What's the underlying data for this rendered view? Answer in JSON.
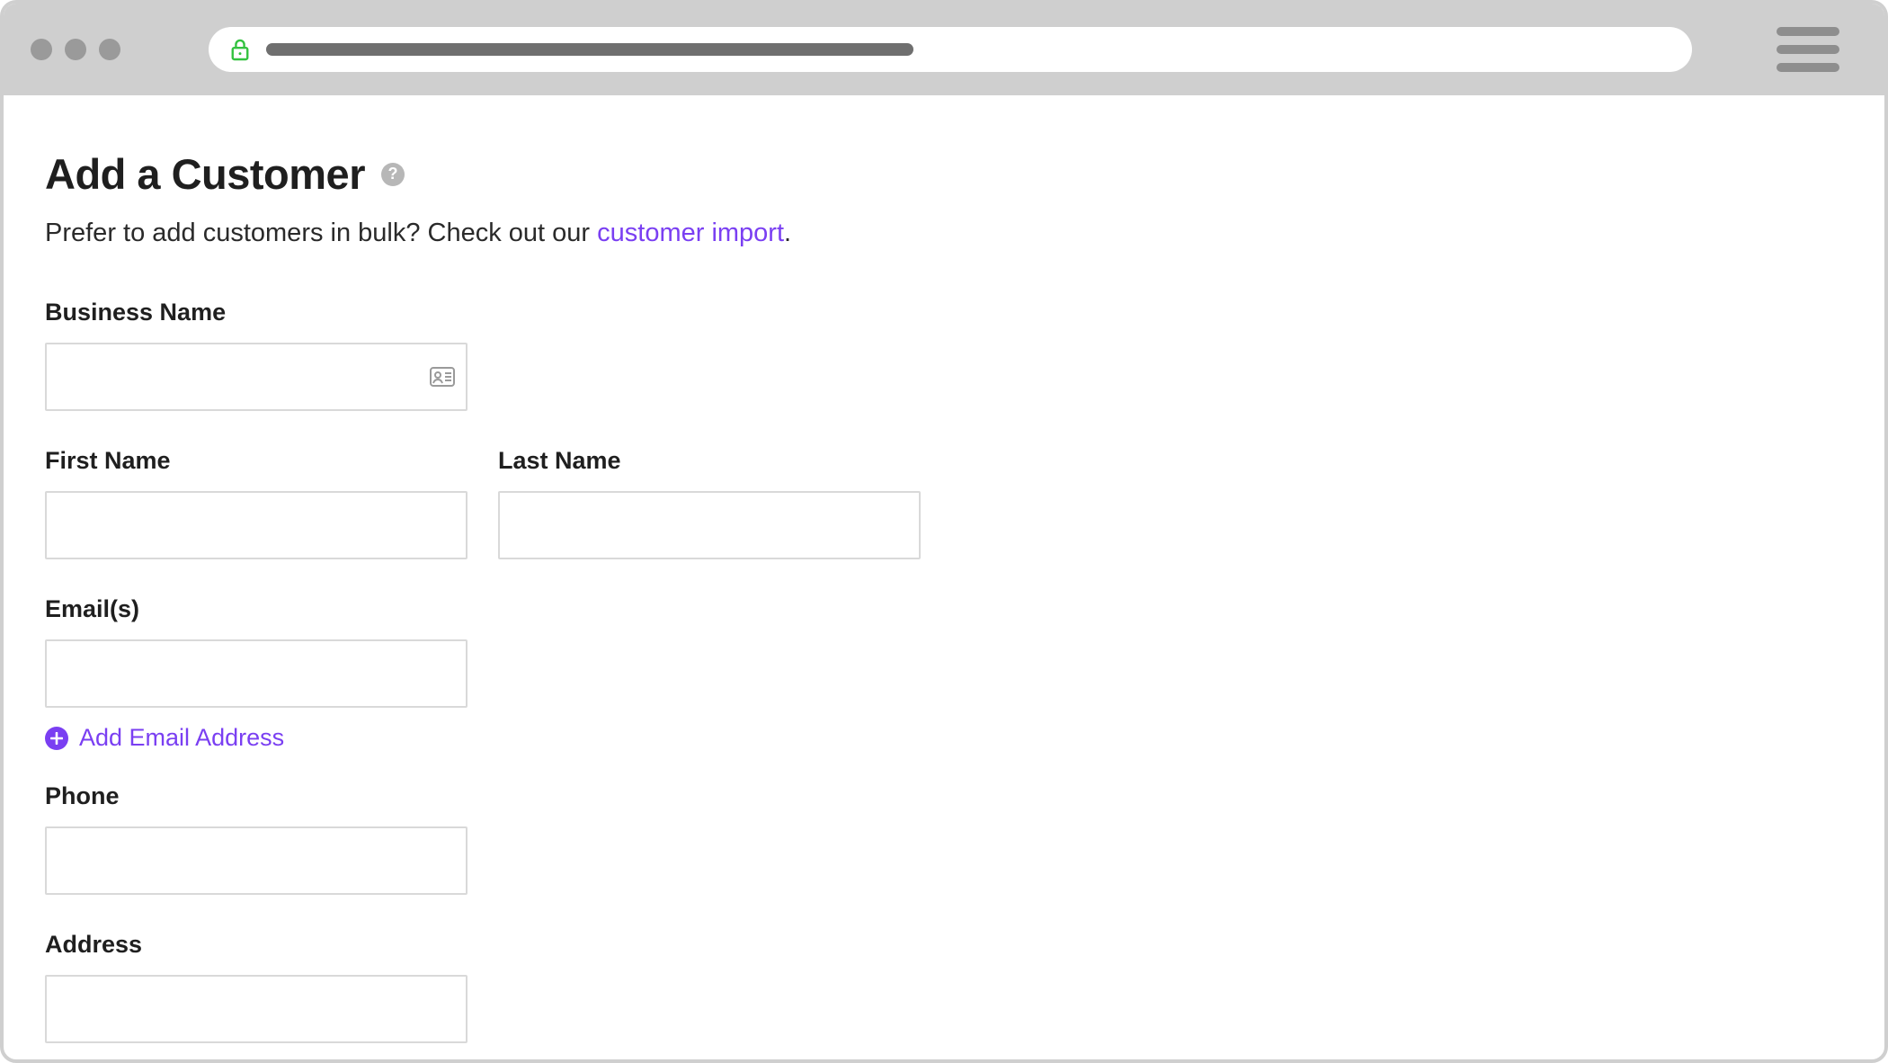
{
  "browser": {
    "menu_label": "Menu"
  },
  "page": {
    "title": "Add a Customer",
    "help_tooltip": "?",
    "subheader_prefix": "Prefer to add customers in bulk? Check out our ",
    "subheader_link": "customer import",
    "subheader_suffix": "."
  },
  "form": {
    "business_name": {
      "label": "Business Name",
      "value": ""
    },
    "first_name": {
      "label": "First Name",
      "value": ""
    },
    "last_name": {
      "label": "Last Name",
      "value": ""
    },
    "emails": {
      "label": "Email(s)",
      "value": "",
      "add_label": "Add Email Address"
    },
    "phone": {
      "label": "Phone",
      "value": ""
    },
    "address": {
      "label": "Address",
      "value": ""
    }
  }
}
